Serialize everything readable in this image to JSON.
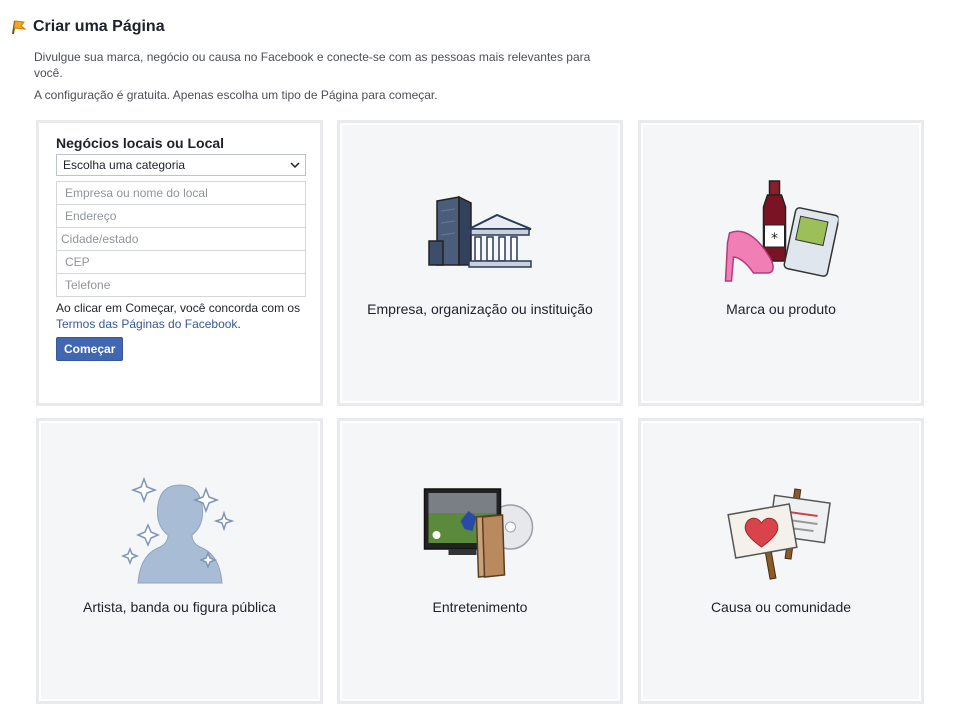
{
  "header": {
    "title": "Criar uma Página",
    "description_1": "Divulgue sua marca, negócio ou causa no Facebook e conecte-se com as pessoas mais relevantes para você.",
    "description_2": "A configuração é gratuita. Apenas escolha um tipo de Página para começar."
  },
  "local_form": {
    "title": "Negócios locais ou Local",
    "category_select": "Escolha uma categoria",
    "fields": {
      "business_name": "Empresa ou nome do local",
      "address": "Endereço",
      "city_state": "Cidade/estado",
      "zip": "CEP",
      "phone": "Telefone"
    },
    "terms_prefix": "Ao clicar em Começar, você concorda com os ",
    "terms_link": "Termos das Páginas do Facebook",
    "terms_suffix": ".",
    "submit_label": "Começar"
  },
  "page_types": {
    "company": "Empresa, organização ou instituição",
    "brand": "Marca ou produto",
    "artist": "Artista, banda ou figura pública",
    "entertainment": "Entretenimento",
    "cause": "Causa ou comunidade"
  },
  "colors": {
    "accent": "#4267b2",
    "link": "#365899",
    "card_border": "#e9eaed",
    "card_bg": "#f5f6f7"
  },
  "icons": [
    "flag-icon",
    "chevron-down-icon",
    "buildings-icon",
    "brand-products-icon",
    "artist-silhouette-icon",
    "entertainment-icon",
    "cause-signs-icon"
  ]
}
